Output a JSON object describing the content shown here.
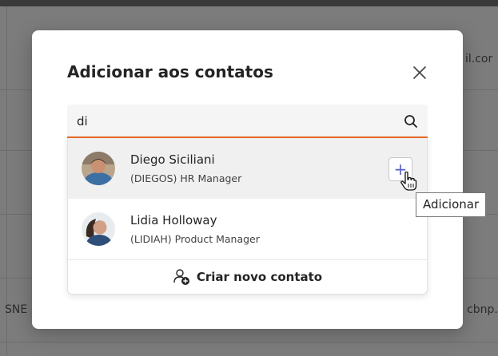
{
  "background": {
    "right_fragment_1": "il.cor",
    "right_fragment_2": "cbnp.",
    "left_fragment": "SNE"
  },
  "modal": {
    "title": "Adicionar aos contatos",
    "close_icon": "close-icon"
  },
  "search": {
    "value": "di",
    "icon": "search-icon"
  },
  "results": [
    {
      "name": "Diego Siciliani",
      "role": "(DIEGOS) HR Manager",
      "hovered": true
    },
    {
      "name": "Lidia Holloway",
      "role": "(LIDIAH) Product Manager",
      "hovered": false
    }
  ],
  "add_button": {
    "symbol": "+"
  },
  "create_contact": {
    "label": "Criar novo contato",
    "icon": "person-add-icon"
  },
  "tooltip": {
    "text": "Adicionar"
  },
  "colors": {
    "accent": "#e86a25",
    "add_icon": "#5a5fc8",
    "overlay": "#7c7c7c"
  }
}
